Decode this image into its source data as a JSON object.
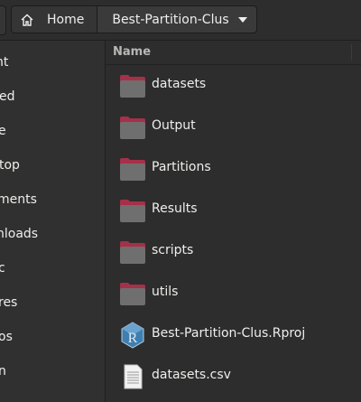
{
  "header": {
    "home_label": "Home",
    "current_folder": "Best-Partition-Clus"
  },
  "sidebar": {
    "items": [
      {
        "label": "nt"
      },
      {
        "label": "ed"
      },
      {
        "label": "e"
      },
      {
        "label": "top"
      },
      {
        "label": "ments"
      },
      {
        "label": "nloads"
      },
      {
        "label": "c"
      },
      {
        "label": "res"
      },
      {
        "label": "os"
      },
      {
        "label": "n"
      }
    ]
  },
  "files": {
    "column_name": "Name",
    "items": [
      {
        "name": "datasets",
        "icon": "folder-icon"
      },
      {
        "name": "Output",
        "icon": "folder-icon"
      },
      {
        "name": "Partitions",
        "icon": "folder-icon"
      },
      {
        "name": "Results",
        "icon": "folder-icon"
      },
      {
        "name": "scripts",
        "icon": "folder-icon"
      },
      {
        "name": "utils",
        "icon": "folder-icon"
      },
      {
        "name": "Best-Partition-Clus.Rproj",
        "icon": "rproject-icon"
      },
      {
        "name": "datasets.csv",
        "icon": "text-file-icon"
      }
    ]
  },
  "colors": {
    "background": "#2d2d2d",
    "sidebar_background": "#303030",
    "folder_tab": "#a6304a",
    "folder_body": "#6f6f6f",
    "text": "#eeeeec"
  }
}
